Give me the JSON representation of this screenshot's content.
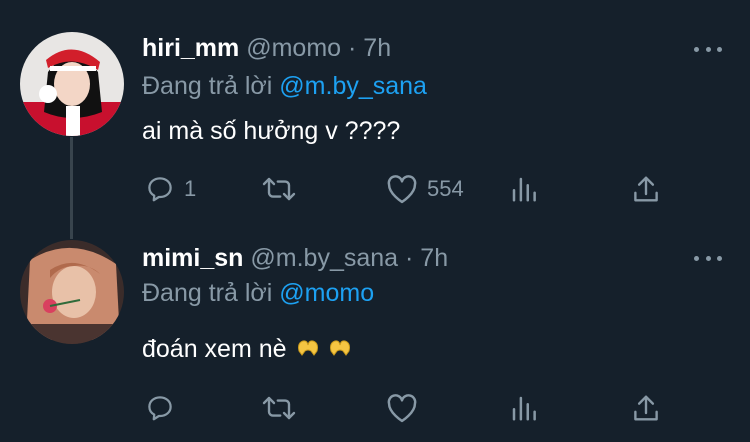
{
  "tweets": [
    {
      "display_name": "hiri_mm",
      "handle": "@momo",
      "separator": "·",
      "time": "7h",
      "reply_prefix": "Đang trả lời",
      "reply_to": "@m.by_sana",
      "text": "ai mà số hưởng v ????",
      "reply_count": "1",
      "retweet_count": "",
      "like_count": "554"
    },
    {
      "display_name": "mimi_sn",
      "handle": "@m.by_sana",
      "separator": "·",
      "time": "7h",
      "reply_prefix": "Đang trả lời",
      "reply_to": "@momo",
      "text": "đoán xem nè",
      "reply_count": "",
      "retweet_count": "",
      "like_count": ""
    }
  ],
  "colors": {
    "background": "#15202b",
    "muted": "#8899a6",
    "link": "#1da1f2",
    "thread_line": "#38444d"
  },
  "icons": [
    "more-icon",
    "reply-icon",
    "retweet-icon",
    "like-icon",
    "analytics-icon",
    "share-icon",
    "heart-hands-emoji"
  ]
}
